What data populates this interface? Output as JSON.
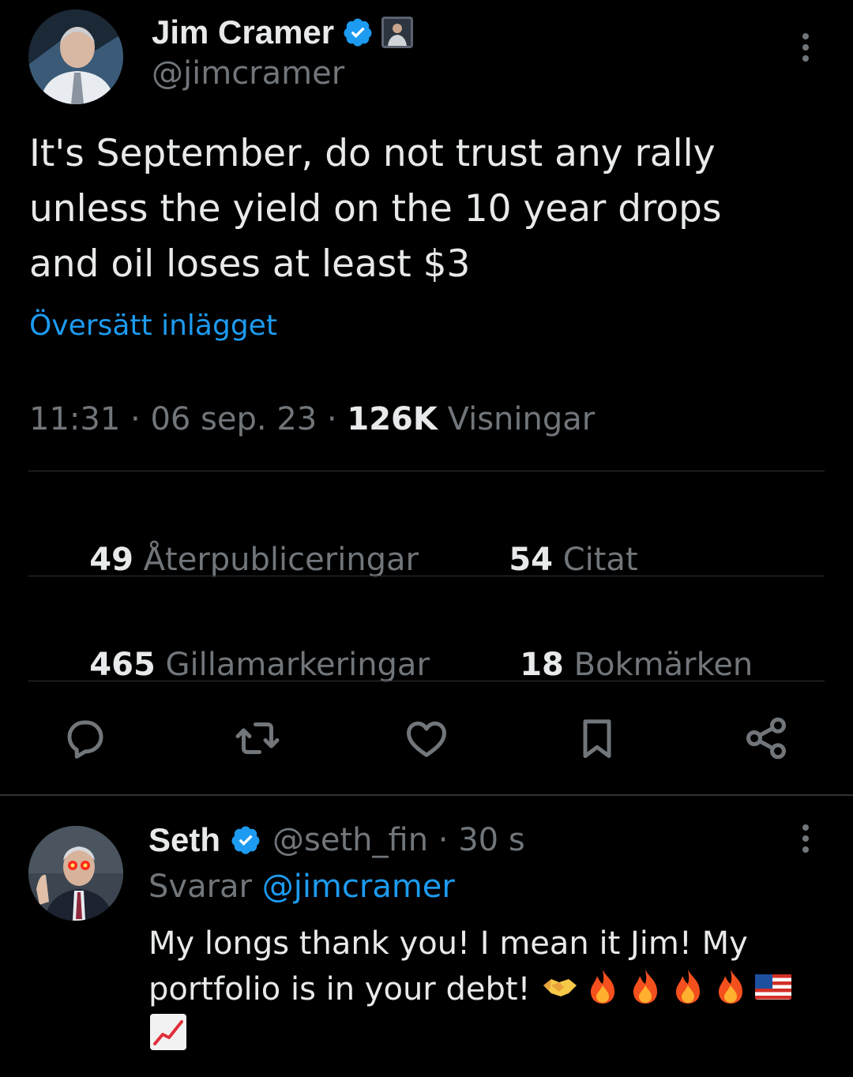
{
  "tweet": {
    "author_name": "Jim Cramer",
    "author_handle": "@jimcramer",
    "text": "It's September, do not trust any rally\nunless the yield on the 10 year drops\nand oil loses at least $3",
    "translate_label": "Översätt inlägget",
    "time": "11:31",
    "separator": " · ",
    "date": "06 sep. 23",
    "views_count": "126K",
    "views_label": " Visningar",
    "stats": {
      "reposts_count": "49",
      "reposts_label": " Återpubliceringar",
      "quotes_count": "54",
      "quotes_label": " Citat",
      "likes_count": "465",
      "likes_label": " Gillamarkeringar",
      "bookmarks_count": "18",
      "bookmarks_label": " Bokmärken"
    }
  },
  "actions": [
    "reply-icon",
    "retweet-icon",
    "like-icon",
    "bookmark-icon",
    "share-icon"
  ],
  "reply": {
    "author_name": "Seth",
    "author_handle": "@seth_fin",
    "separator": " · ",
    "time": "30 s",
    "replying_label": "Svarar ",
    "replying_mention": "@jimcramer",
    "text": "My longs thank you! I mean it Jim! My portfolio is in your debt! ",
    "emoji": [
      "handshake-emoji",
      "fire-emoji",
      "fire-emoji",
      "fire-emoji",
      "fire-emoji",
      "us-flag-emoji",
      "chart-increasing-emoji"
    ]
  },
  "colors": {
    "background": "#000000",
    "text": "#e7e9ea",
    "secondary": "#71767b",
    "link": "#1d9bf0",
    "divider": "#2f3336"
  }
}
